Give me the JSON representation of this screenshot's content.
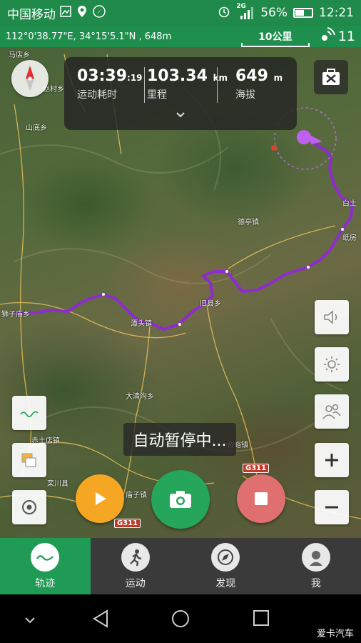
{
  "status_bar": {
    "carrier": "中国移动",
    "network": "2G",
    "battery": "56%",
    "battery_level": 0.56,
    "time": "12:21"
  },
  "info_bar": {
    "coordinates": "112°0'38.77\"E, 34°15'5.1\"N , 648m",
    "scale": "10公里",
    "satellites": "11"
  },
  "stats": {
    "duration_main": "03:39",
    "duration_sec": ":19",
    "duration_label": "运动耗时",
    "distance": "103.34",
    "distance_unit": "km",
    "distance_label": "里程",
    "altitude": "649",
    "altitude_unit": "m",
    "altitude_label": "海拔"
  },
  "map": {
    "places": [
      "马店乡",
      "赵村乡",
      "山底乡",
      "旧县乡",
      "德亭镇",
      "狮子庙乡",
      "潭头镇",
      "大清沟乡",
      "赤土店镇",
      "栾川县",
      "庙子镇",
      "合峪镇",
      "纸房",
      "白土"
    ],
    "road_tags": [
      "G311",
      "G311"
    ],
    "route_color": "#8e2bd1"
  },
  "toast": "自动暂停中...",
  "nav": {
    "tabs": [
      {
        "label": "轨迹",
        "icon": "track-icon"
      },
      {
        "label": "运动",
        "icon": "sport-icon"
      },
      {
        "label": "发现",
        "icon": "discover-icon"
      },
      {
        "label": "我",
        "icon": "profile-icon"
      }
    ]
  },
  "watermark": "爱卡汽车",
  "colors": {
    "primary_green": "#1f8a4a",
    "play_orange": "#f5a623",
    "camera_green": "#26a65b",
    "stop_red": "#e07070"
  }
}
